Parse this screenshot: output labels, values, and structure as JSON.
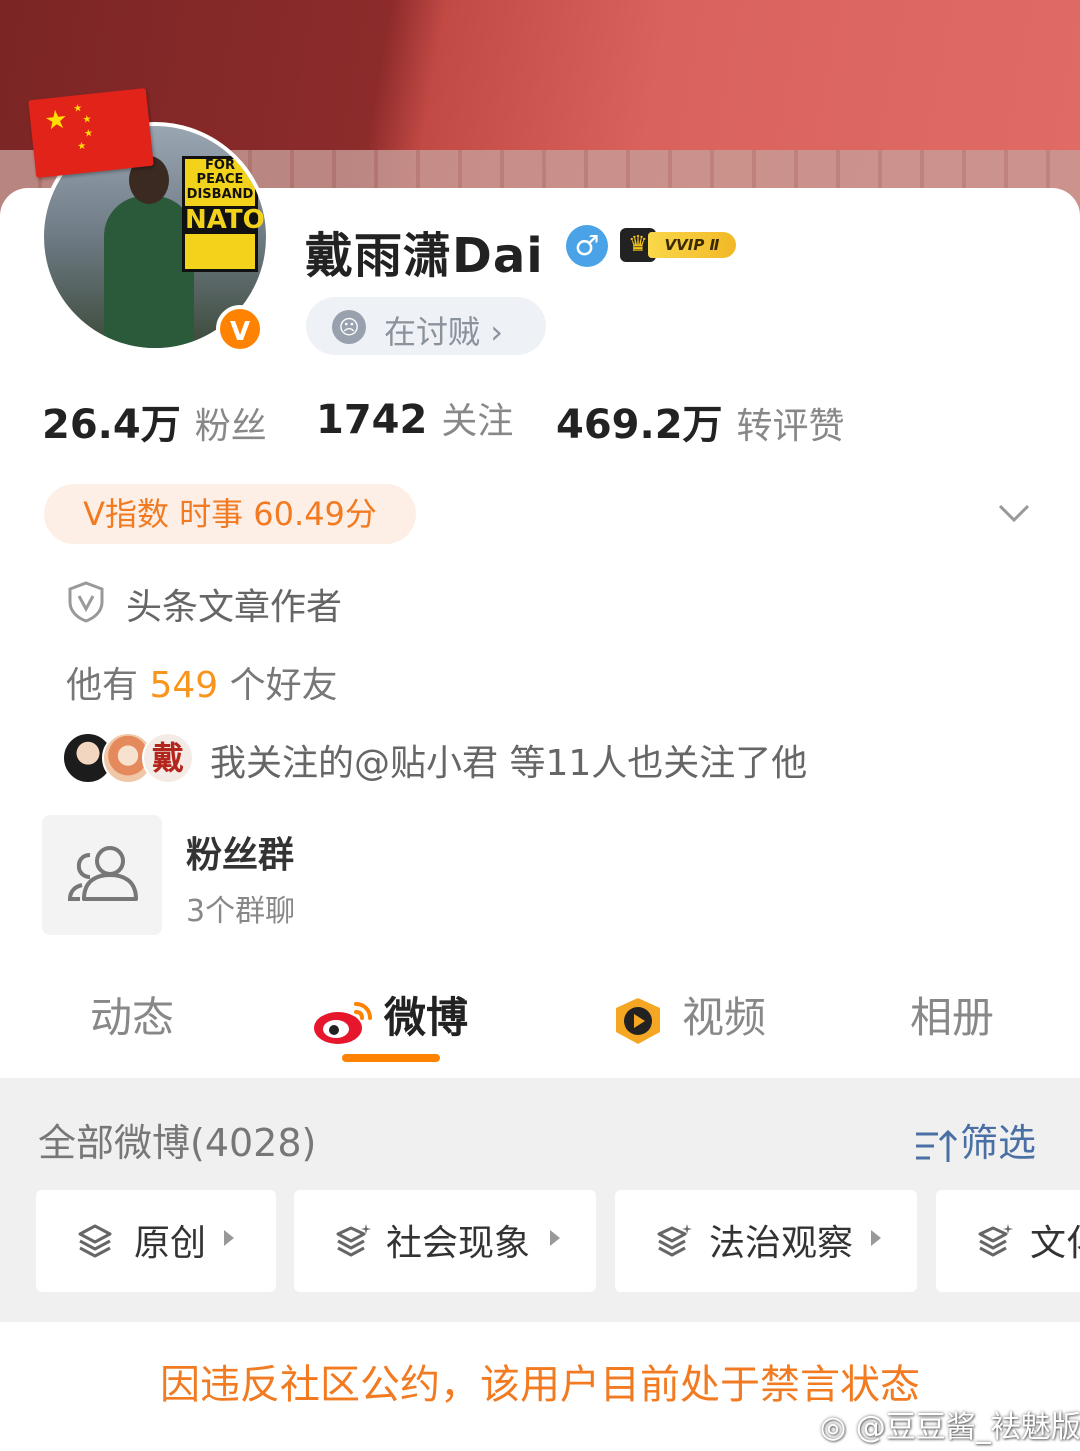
{
  "profile": {
    "name": "戴雨潇Dai",
    "gender_symbol": "♂",
    "vip_label": "VVIP Ⅱ",
    "verified_symbol": "V",
    "mood": "在讨贼",
    "mood_arrow": "›"
  },
  "avatar": {
    "sign_lines": [
      "FOR PEACE",
      "DISBAND"
    ],
    "sign_big": "NATO"
  },
  "stats": [
    {
      "value": "26.4万",
      "label": "粉丝"
    },
    {
      "value": "1742",
      "label": "关注"
    },
    {
      "value": "469.2万",
      "label": "转评赞"
    }
  ],
  "v_index": "V指数 时事 60.49分",
  "certification": "头条文章作者",
  "friends": {
    "prefix": "他有",
    "count": "549",
    "suffix": "个好友"
  },
  "mutual_follow": {
    "text": "我关注的@贴小君 等11人也关注了他",
    "avatar3_char": "戴"
  },
  "fan_group": {
    "title": "粉丝群",
    "subtitle": "3个群聊"
  },
  "tabs": [
    {
      "label": "动态",
      "active": false
    },
    {
      "label": "微博",
      "active": true
    },
    {
      "label": "视频",
      "active": false
    },
    {
      "label": "相册",
      "active": false
    }
  ],
  "feed": {
    "all_label": "全部微博(4028)",
    "filter_label": "筛选",
    "chips": [
      "原创",
      "社会现象",
      "法治观察",
      "文化"
    ]
  },
  "notice": "因违反社区公约，该用户目前处于禁言状态",
  "watermark": "@豆豆酱_袪魅版",
  "colors": {
    "accent_orange": "#ff8200",
    "notice_orange": "#f27b22",
    "friend_count": "#f7951d",
    "filter_blue": "#4a6fa5",
    "gender_blue": "#4aa3e6"
  }
}
